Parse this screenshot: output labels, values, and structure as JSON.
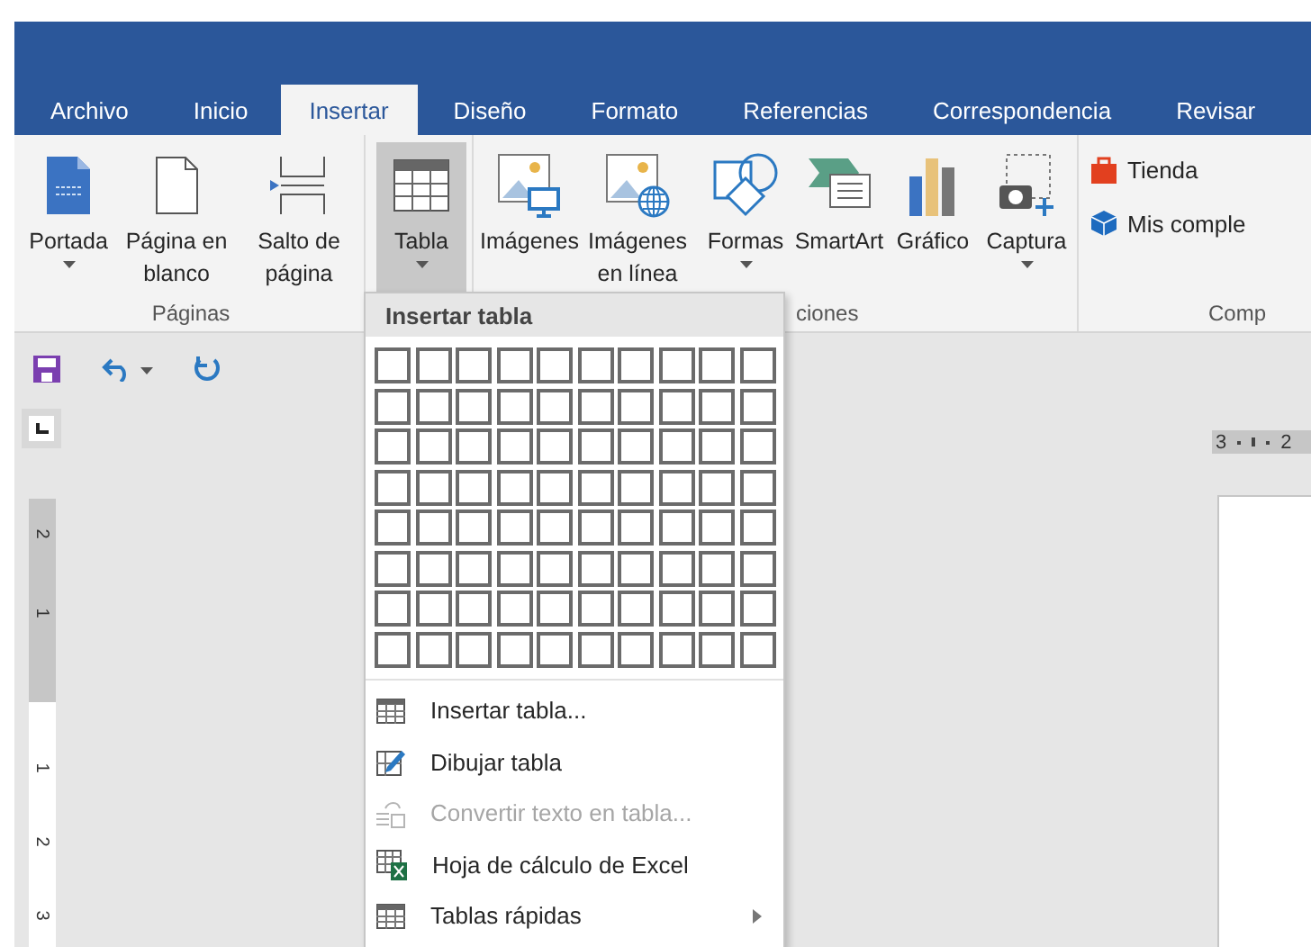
{
  "tabs": [
    {
      "label": "Archivo",
      "selected": false
    },
    {
      "label": "Inicio",
      "selected": false
    },
    {
      "label": "Insertar",
      "selected": true
    },
    {
      "label": "Diseño",
      "selected": false
    },
    {
      "label": "Formato",
      "selected": false
    },
    {
      "label": "Referencias",
      "selected": false
    },
    {
      "label": "Correspondencia",
      "selected": false
    },
    {
      "label": "Revisar",
      "selected": false
    }
  ],
  "ribbon": {
    "groups": [
      {
        "label": "Páginas",
        "buttons": [
          {
            "kind": "cover",
            "label": "Portada",
            "dropdown": true,
            "pressed": false
          },
          {
            "kind": "blank",
            "label": "Página en blanco",
            "dropdown": false,
            "pressed": false
          },
          {
            "kind": "break",
            "label": "Salto de página",
            "dropdown": false,
            "pressed": false
          }
        ]
      },
      {
        "buttons": [
          {
            "kind": "table",
            "label": "Tabla",
            "dropdown": true,
            "pressed": true
          }
        ]
      },
      {
        "label": "ciones",
        "buttons": [
          {
            "kind": "pictures",
            "label": "Imágenes",
            "dropdown": false,
            "pressed": false
          },
          {
            "kind": "online",
            "label": "Imágenes en línea",
            "dropdown": false,
            "pressed": false
          },
          {
            "kind": "shapes",
            "label": "Formas",
            "dropdown": true,
            "pressed": false
          },
          {
            "kind": "smartart",
            "label": "SmartArt",
            "dropdown": false,
            "pressed": false
          },
          {
            "kind": "chart",
            "label": "Gráfico",
            "dropdown": false,
            "pressed": false
          },
          {
            "kind": "capture",
            "label": "Captura",
            "dropdown": true,
            "pressed": false
          }
        ]
      },
      {
        "label": "Comp",
        "buttons": [
          {
            "kind": "store",
            "label": "Tienda"
          },
          {
            "kind": "addins",
            "label": "Mis comple"
          }
        ]
      }
    ]
  },
  "table_menu": {
    "title": "Insertar tabla",
    "items": [
      {
        "kind": "table",
        "label": "Insertar tabla...",
        "disabled": false,
        "submenu": false
      },
      {
        "kind": "draw",
        "label": "Dibujar tabla",
        "disabled": false,
        "submenu": false
      },
      {
        "kind": "convert",
        "label": "Convertir texto en tabla...",
        "disabled": true,
        "submenu": false
      },
      {
        "kind": "excel",
        "label": "Hoja de cálculo de Excel",
        "disabled": false,
        "submenu": false
      },
      {
        "kind": "table",
        "label": "Tablas rápidas",
        "disabled": false,
        "submenu": true
      }
    ]
  },
  "horizontal_ruler": [
    "3",
    "2"
  ],
  "vertical_ruler": [
    "2",
    "1",
    "1",
    "2",
    "3"
  ]
}
